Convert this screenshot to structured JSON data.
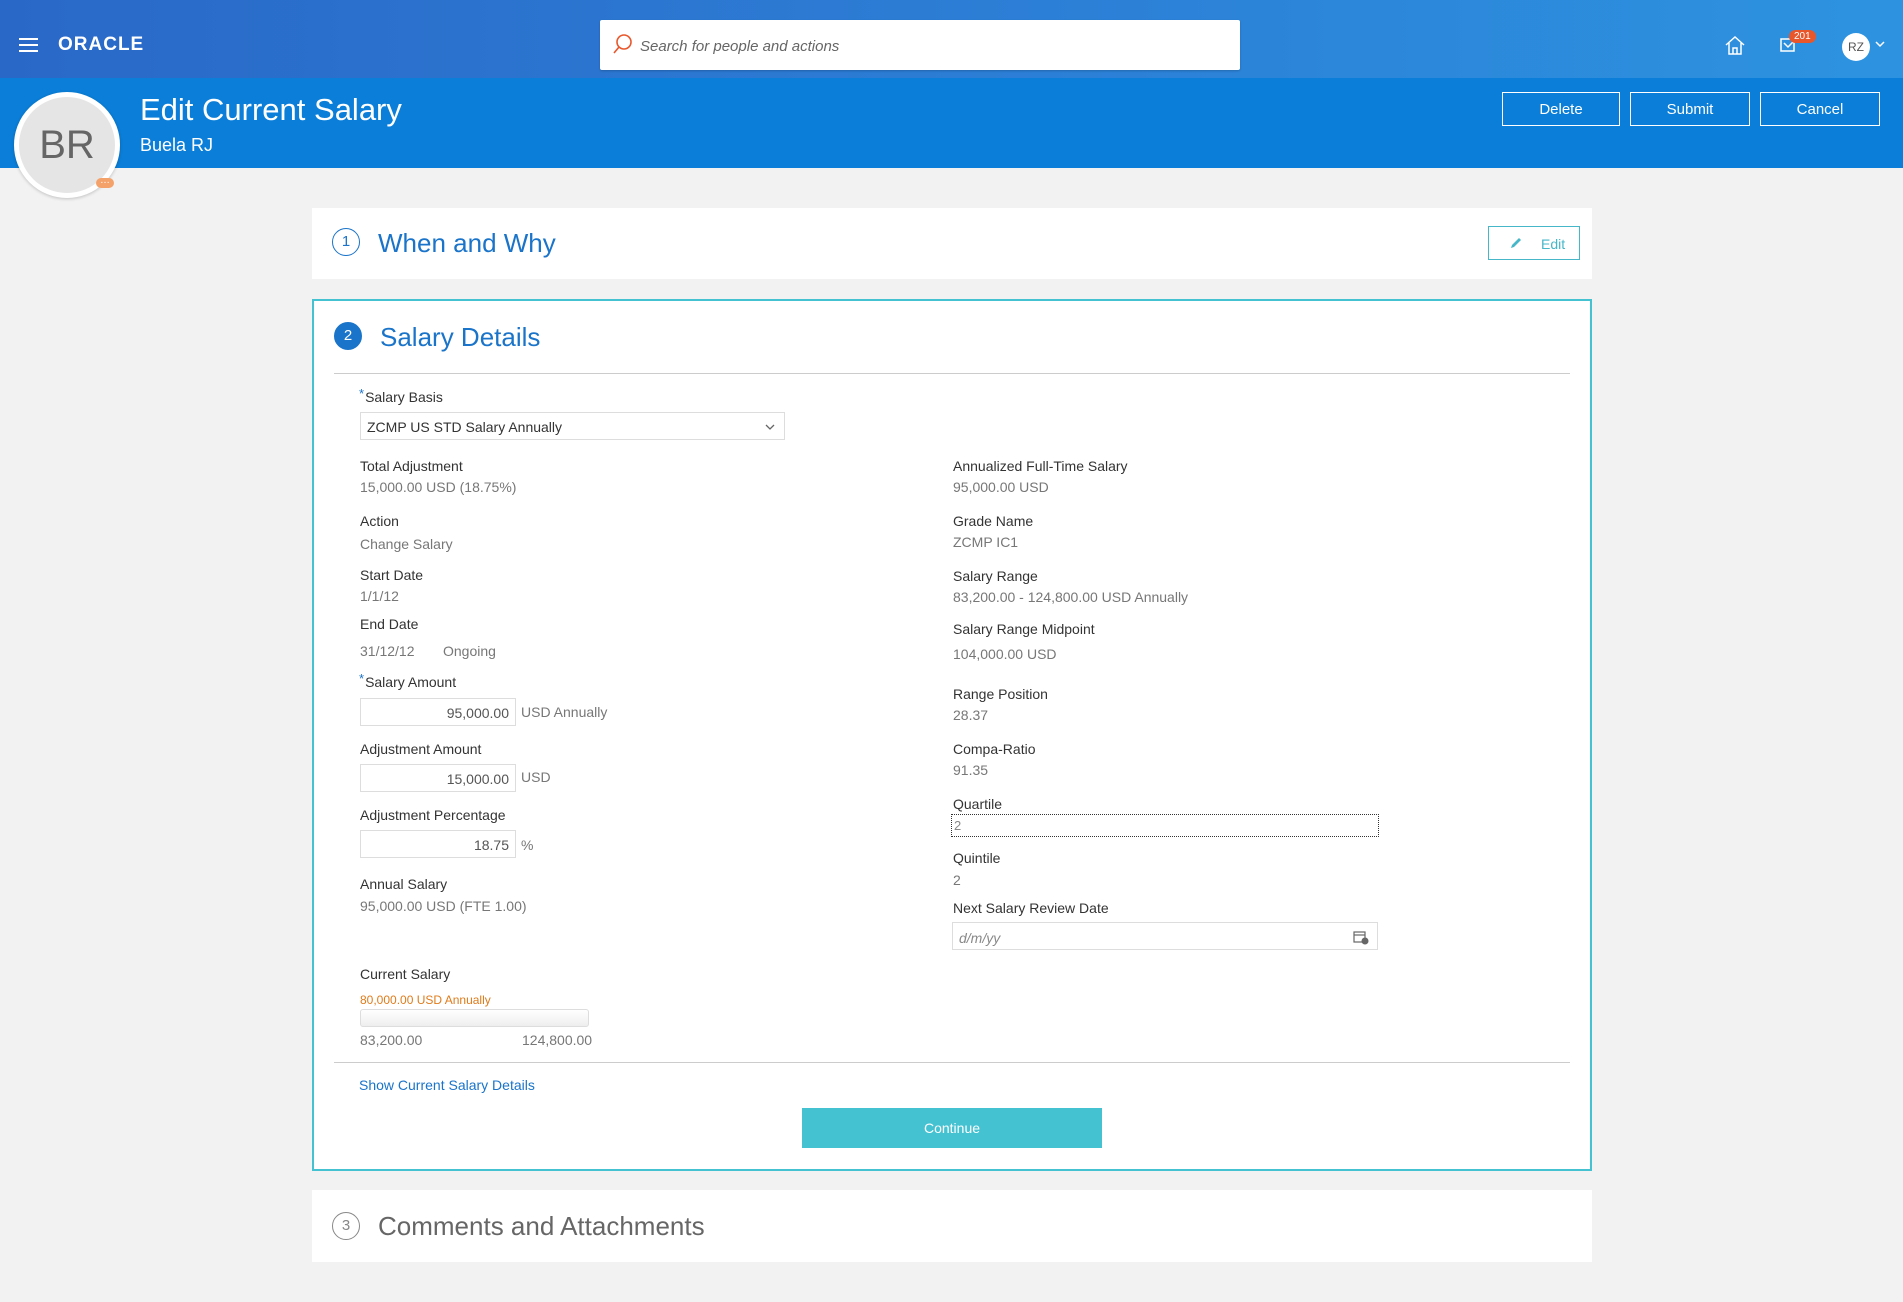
{
  "navbar": {
    "brand": "ORACLE",
    "search_placeholder": "Search for people and actions",
    "notification_count": "201",
    "user_initials": "RZ"
  },
  "header": {
    "title": "Edit Current Salary",
    "subtitle": "Buela RJ",
    "avatar_initials": "BR",
    "avatar_more": "…",
    "buttons": {
      "delete": "Delete",
      "submit": "Submit",
      "cancel": "Cancel"
    }
  },
  "sections": {
    "when_why": {
      "number": "1",
      "title": "When and Why",
      "edit_label": "Edit"
    },
    "salary_details": {
      "number": "2",
      "title": "Salary Details"
    },
    "comments": {
      "number": "3",
      "title": "Comments and Attachments"
    }
  },
  "salary": {
    "req_mark": "*",
    "salary_basis": {
      "label": "Salary Basis",
      "value": "ZCMP US STD Salary Annually"
    },
    "total_adjustment": {
      "label": "Total Adjustment",
      "value": "15,000.00 USD (18.75%)"
    },
    "action": {
      "label": "Action",
      "value": "Change Salary"
    },
    "start_date": {
      "label": "Start Date",
      "value": "1/1/12"
    },
    "end_date": {
      "label": "End Date",
      "value": "31/12/12",
      "ongoing": "Ongoing"
    },
    "salary_amount": {
      "label": "Salary Amount",
      "value": "95,000.00",
      "unit": "USD Annually"
    },
    "adjustment_amount": {
      "label": "Adjustment Amount",
      "value": "15,000.00",
      "unit": "USD"
    },
    "adjustment_percentage": {
      "label": "Adjustment Percentage",
      "value": "18.75",
      "unit": "%"
    },
    "annual_salary": {
      "label": "Annual Salary",
      "value": "95,000.00 USD (FTE 1.00)"
    },
    "current_salary": {
      "label": "Current Salary",
      "value": "80,000.00 USD Annually",
      "range_min": "83,200.00",
      "range_max": "124,800.00"
    },
    "annualized_full_time": {
      "label": "Annualized Full-Time Salary",
      "value": "95,000.00 USD"
    },
    "grade_name": {
      "label": "Grade Name",
      "value": "ZCMP IC1"
    },
    "salary_range": {
      "label": "Salary Range",
      "value": "83,200.00 - 124,800.00 USD Annually"
    },
    "salary_range_midpoint": {
      "label": "Salary Range Midpoint",
      "value": "104,000.00 USD"
    },
    "range_position": {
      "label": "Range Position",
      "value": "28.37"
    },
    "compa_ratio": {
      "label": "Compa-Ratio",
      "value": "91.35"
    },
    "quartile": {
      "label": "Quartile",
      "value": "2"
    },
    "quintile": {
      "label": "Quintile",
      "value": "2"
    },
    "next_review_date": {
      "label": "Next Salary Review Date",
      "placeholder": "d/m/yy"
    },
    "show_details_link": "Show Current Salary Details",
    "continue_label": "Continue"
  },
  "colors": {
    "navbar": "#2c7fd6",
    "header_band": "#0a7ed8",
    "accent": "#1a74c9",
    "teal": "#45c2d2",
    "orange": "#e07b1a"
  }
}
